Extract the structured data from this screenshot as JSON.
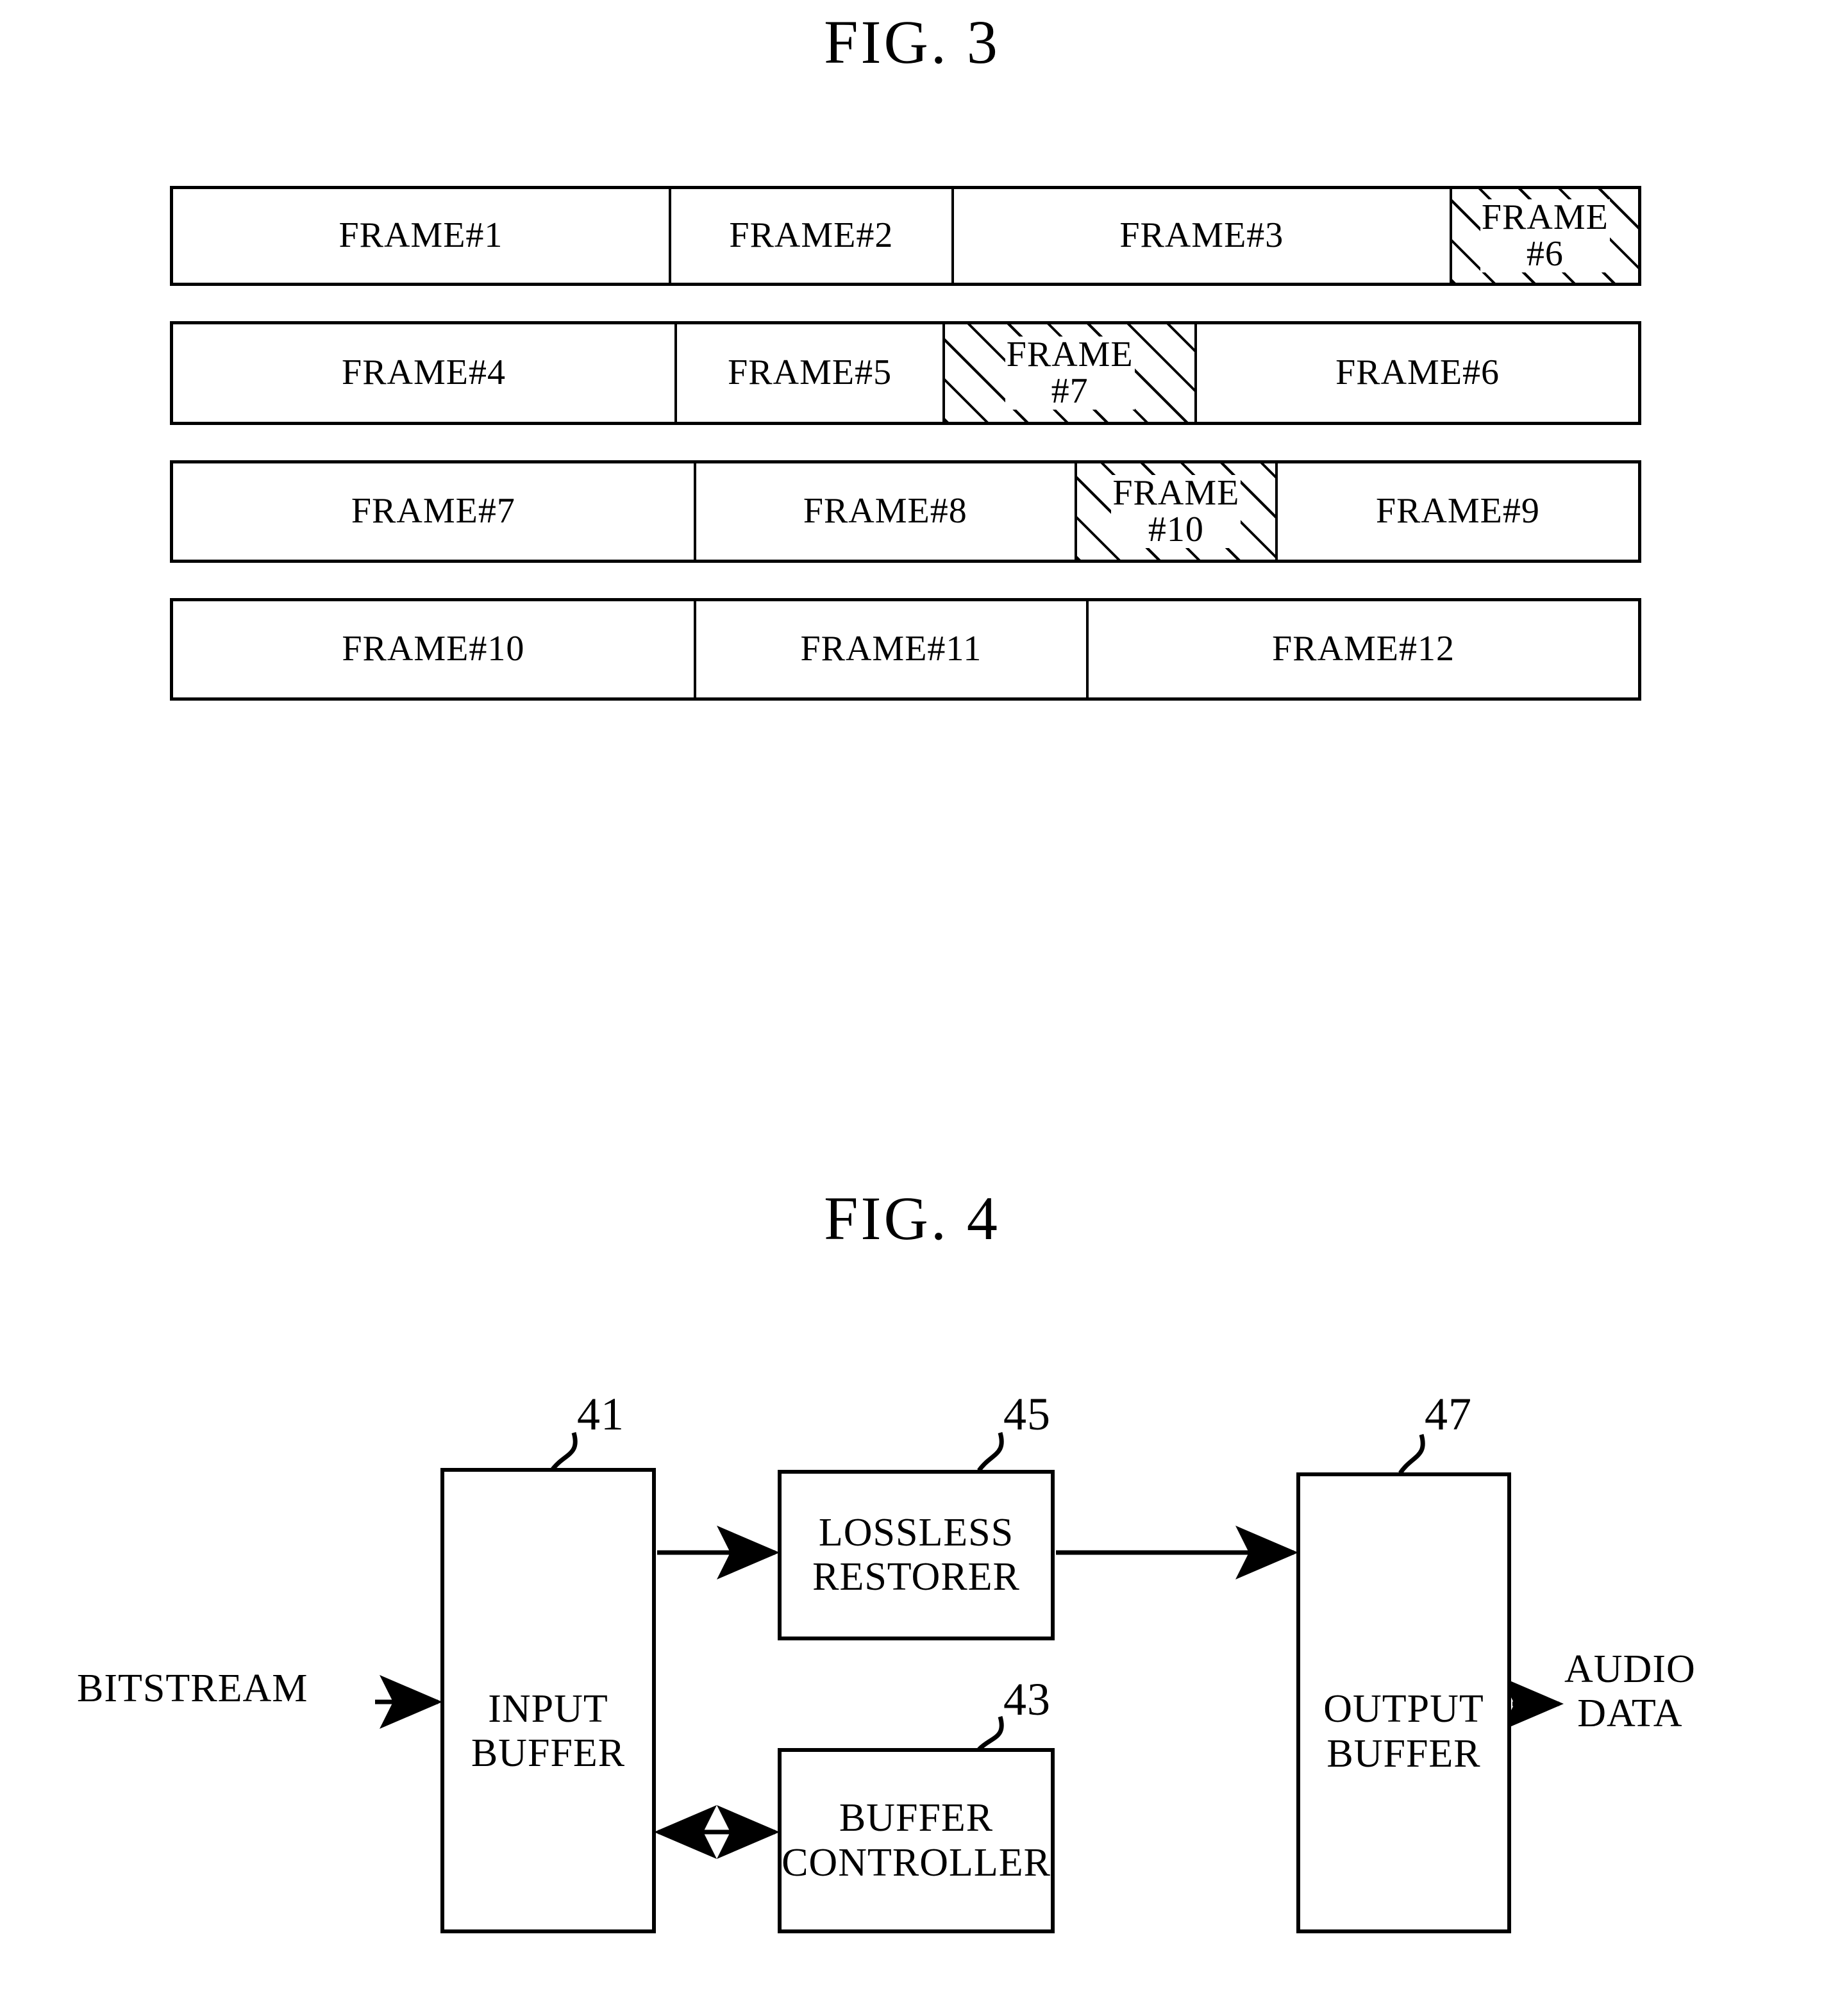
{
  "figures": [
    {
      "id": "fig3",
      "title": "FIG. 3",
      "rows": [
        {
          "cells": [
            {
              "label": "FRAME#1",
              "width_pct": 34.0,
              "hatched": false
            },
            {
              "label": "FRAME#2",
              "width_pct": 19.3,
              "hatched": false
            },
            {
              "label": "FRAME#3",
              "width_pct": 34.0,
              "hatched": false
            },
            {
              "label": "FRAME\n#6",
              "width_pct": 12.7,
              "hatched": true
            }
          ]
        },
        {
          "cells": [
            {
              "label": "FRAME#4",
              "width_pct": 34.4,
              "hatched": false
            },
            {
              "label": "FRAME#5",
              "width_pct": 18.3,
              "hatched": false
            },
            {
              "label": "FRAME\n#7",
              "width_pct": 17.2,
              "hatched": true
            },
            {
              "label": "FRAME#6",
              "width_pct": 30.1,
              "hatched": false
            }
          ]
        },
        {
          "cells": [
            {
              "label": "FRAME#7",
              "width_pct": 35.7,
              "hatched": false
            },
            {
              "label": "FRAME#8",
              "width_pct": 26.0,
              "hatched": false
            },
            {
              "label": "FRAME\n#10",
              "width_pct": 13.7,
              "hatched": true
            },
            {
              "label": "FRAME#9",
              "width_pct": 24.6,
              "hatched": false
            }
          ]
        },
        {
          "cells": [
            {
              "label": "FRAME#10",
              "width_pct": 35.7,
              "hatched": false
            },
            {
              "label": "FRAME#11",
              "width_pct": 26.8,
              "hatched": false
            },
            {
              "label": "FRAME#12",
              "width_pct": 37.5,
              "hatched": false
            }
          ]
        }
      ]
    },
    {
      "id": "fig4",
      "title": "FIG. 4",
      "blocks": [
        {
          "key": "input",
          "label": "INPUT\nBUFFER",
          "ref": "41"
        },
        {
          "key": "lossless",
          "label": "LOSSLESS\nRESTORER",
          "ref": "45"
        },
        {
          "key": "bufctrl",
          "label": "BUFFER\nCONTROLLER",
          "ref": "43"
        },
        {
          "key": "output",
          "label": "OUTPUT\nBUFFER",
          "ref": "47"
        }
      ],
      "signals": {
        "input_label": "BITSTREAM",
        "output_label": "AUDIO\nDATA"
      },
      "connections": [
        {
          "from": "bitstream",
          "to": "input",
          "type": "arrow"
        },
        {
          "from": "input",
          "to": "lossless",
          "type": "arrow"
        },
        {
          "from": "lossless",
          "to": "output",
          "type": "arrow"
        },
        {
          "from": "input",
          "to": "bufctrl",
          "type": "double-arrow"
        },
        {
          "from": "output",
          "to": "audio",
          "type": "arrow"
        }
      ]
    }
  ],
  "colors": {
    "ink": "#000000",
    "paper": "#ffffff"
  }
}
